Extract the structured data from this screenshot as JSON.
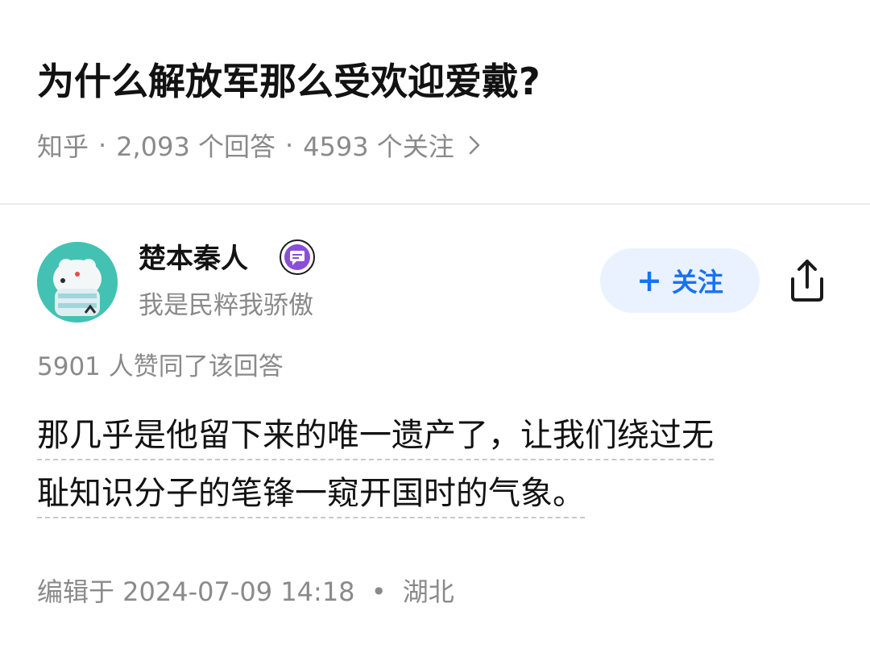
{
  "question": {
    "title": "为什么解放军那么受欢迎爱戴?",
    "source": "知乎",
    "answer_count": "2,093 个回答",
    "follow_count": "4593 个关注",
    "separator": "·"
  },
  "author": {
    "name": "楚本秦人",
    "bio": "我是民粹我骄傲",
    "badge_icon": "comment-badge-icon",
    "follow_label": "关注",
    "follow_plus": "+"
  },
  "answer": {
    "vote_text": "5901 人赞同了该回答",
    "lines": [
      "那几乎是他留下来的唯一遗产了，让我们绕过无",
      "耻知识分子的笔锋一窥开国时的气象。"
    ],
    "edit_time": "编辑于 2024-07-09 14:18",
    "location": "湖北",
    "separator": "•"
  },
  "colors": {
    "accent": "#1772f6",
    "follow_bg": "#eaf2ff",
    "meta_gray": "#8a8a8a",
    "avatar_bg": "#43c2b3",
    "badge_purple": "#8a4fd8"
  }
}
